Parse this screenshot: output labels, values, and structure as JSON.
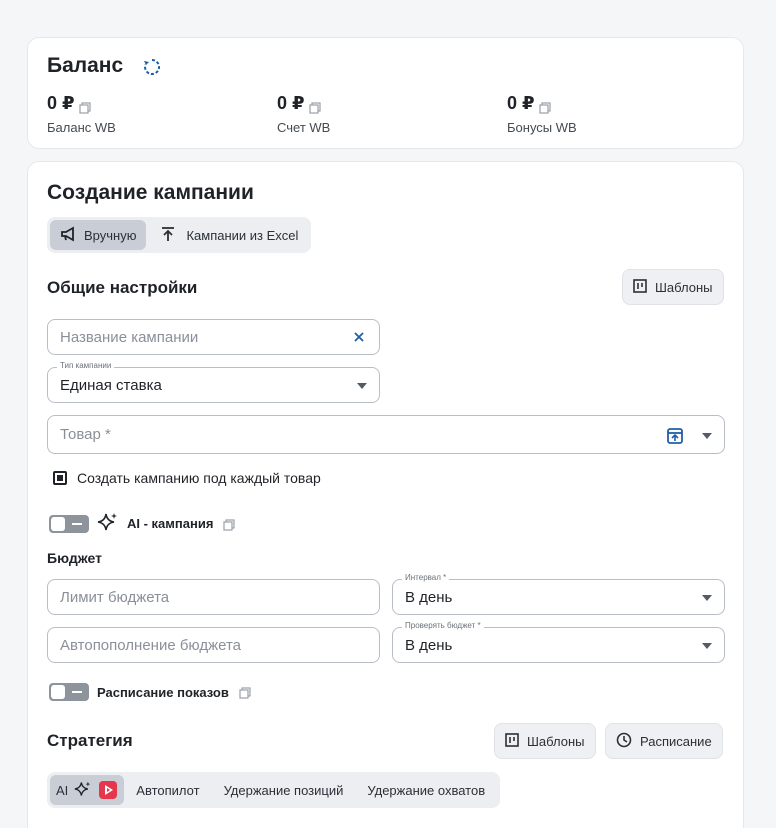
{
  "balance": {
    "title": "Баланс",
    "items": [
      {
        "value": "0 ₽",
        "label": "Баланс WB"
      },
      {
        "value": "0 ₽",
        "label": "Счет WB"
      },
      {
        "value": "0 ₽",
        "label": "Бонусы WB"
      }
    ]
  },
  "create": {
    "title": "Создание кампании",
    "mode_tabs": [
      {
        "label": "Вручную",
        "active": true
      },
      {
        "label": "Кампании из Excel",
        "active": false
      }
    ],
    "general_title": "Общие настройки",
    "templates_label": "Шаблоны",
    "campaign_name": {
      "placeholder": "Название кампании",
      "value": ""
    },
    "campaign_type": {
      "legend": "Тип кампании",
      "value": "Единая ставка"
    },
    "product": {
      "placeholder": "Товар *"
    },
    "per_product_checkbox": "Создать кампанию под каждый товар",
    "ai_campaign_label": "AI - кампания",
    "budget_title": "Бюджет",
    "budget_limit": {
      "placeholder": "Лимит бюджета"
    },
    "interval": {
      "legend": "Интервал *",
      "value": "В день"
    },
    "auto_topup": {
      "placeholder": "Автопополнение бюджета"
    },
    "check_budget": {
      "legend": "Проверять бюджет *",
      "value": "В день"
    },
    "schedule_toggle_label": "Расписание показов",
    "strategy_title": "Стратегия",
    "strategy_templates_label": "Шаблоны",
    "strategy_schedule_label": "Расписание",
    "strategy_tabs": [
      {
        "label": "AI",
        "active": true
      },
      {
        "label": "Автопилот",
        "active": false
      },
      {
        "label": "Удержание позиций",
        "active": false
      },
      {
        "label": "Удержание охватов",
        "active": false
      }
    ]
  },
  "colors": {
    "accent": "#1f5fa8",
    "video_badge": "#e5364b"
  }
}
